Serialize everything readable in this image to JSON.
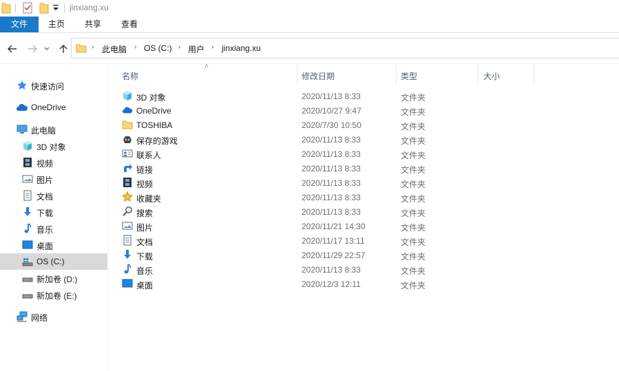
{
  "window": {
    "title": "jinxiang.xu"
  },
  "ribbon": {
    "tabs": [
      "文件",
      "主页",
      "共享",
      "查看"
    ]
  },
  "address": {
    "crumbs": [
      "此电脑",
      "OS (C:)",
      "用户",
      "jinxiang.xu"
    ]
  },
  "nav": {
    "items": [
      {
        "label": "快速访问",
        "icon": "star-icon"
      },
      {
        "label": "OneDrive",
        "icon": "cloud-icon"
      },
      {
        "label": "此电脑",
        "icon": "computer-icon"
      },
      {
        "label": "3D 对象",
        "icon": "cube-icon"
      },
      {
        "label": "视频",
        "icon": "film-icon"
      },
      {
        "label": "图片",
        "icon": "picture-icon"
      },
      {
        "label": "文档",
        "icon": "document-icon"
      },
      {
        "label": "下载",
        "icon": "download-icon"
      },
      {
        "label": "音乐",
        "icon": "music-icon"
      },
      {
        "label": "桌面",
        "icon": "desktop-icon"
      },
      {
        "label": "OS (C:)",
        "icon": "system-drive-icon",
        "selected": true
      },
      {
        "label": "新加卷 (D:)",
        "icon": "drive-icon"
      },
      {
        "label": "新加卷 (E:)",
        "icon": "drive-icon"
      },
      {
        "label": "网络",
        "icon": "network-icon"
      }
    ]
  },
  "columns": {
    "name": "名称",
    "date": "修改日期",
    "type": "类型",
    "size": "大小"
  },
  "files": [
    {
      "name": "3D 对象",
      "date": "2020/11/13 8:33",
      "type": "文件夹",
      "icon": "cube-icon"
    },
    {
      "name": "OneDrive",
      "date": "2020/10/27 9:47",
      "type": "文件夹",
      "icon": "cloud-icon"
    },
    {
      "name": "TOSHIBA",
      "date": "2020/7/30 10:50",
      "type": "文件夹",
      "icon": "folder-icon"
    },
    {
      "name": "保存的游戏",
      "date": "2020/11/13 8:33",
      "type": "文件夹",
      "icon": "saved-games-icon"
    },
    {
      "name": "联系人",
      "date": "2020/11/13 8:33",
      "type": "文件夹",
      "icon": "contacts-icon"
    },
    {
      "name": "链接",
      "date": "2020/11/13 8:33",
      "type": "文件夹",
      "icon": "link-arrow-icon"
    },
    {
      "name": "视频",
      "date": "2020/11/13 8:33",
      "type": "文件夹",
      "icon": "film-icon"
    },
    {
      "name": "收藏夹",
      "date": "2020/11/13 8:33",
      "type": "文件夹",
      "icon": "star-icon"
    },
    {
      "name": "搜索",
      "date": "2020/11/13 8:33",
      "type": "文件夹",
      "icon": "search-icon"
    },
    {
      "name": "图片",
      "date": "2020/11/21 14:30",
      "type": "文件夹",
      "icon": "picture-icon"
    },
    {
      "name": "文档",
      "date": "2020/11/17 13:11",
      "type": "文件夹",
      "icon": "document-icon"
    },
    {
      "name": "下载",
      "date": "2020/11/29 22:57",
      "type": "文件夹",
      "icon": "download-icon"
    },
    {
      "name": "音乐",
      "date": "2020/11/13 8:33",
      "type": "文件夹",
      "icon": "music-icon"
    },
    {
      "name": "桌面",
      "date": "2020/12/3 12:11",
      "type": "文件夹",
      "icon": "desktop-icon"
    }
  ],
  "colors": {
    "accent": "#1979ca",
    "folder": "#f8d775",
    "selection": "#d9d9d9",
    "header_text": "#4c607a"
  }
}
